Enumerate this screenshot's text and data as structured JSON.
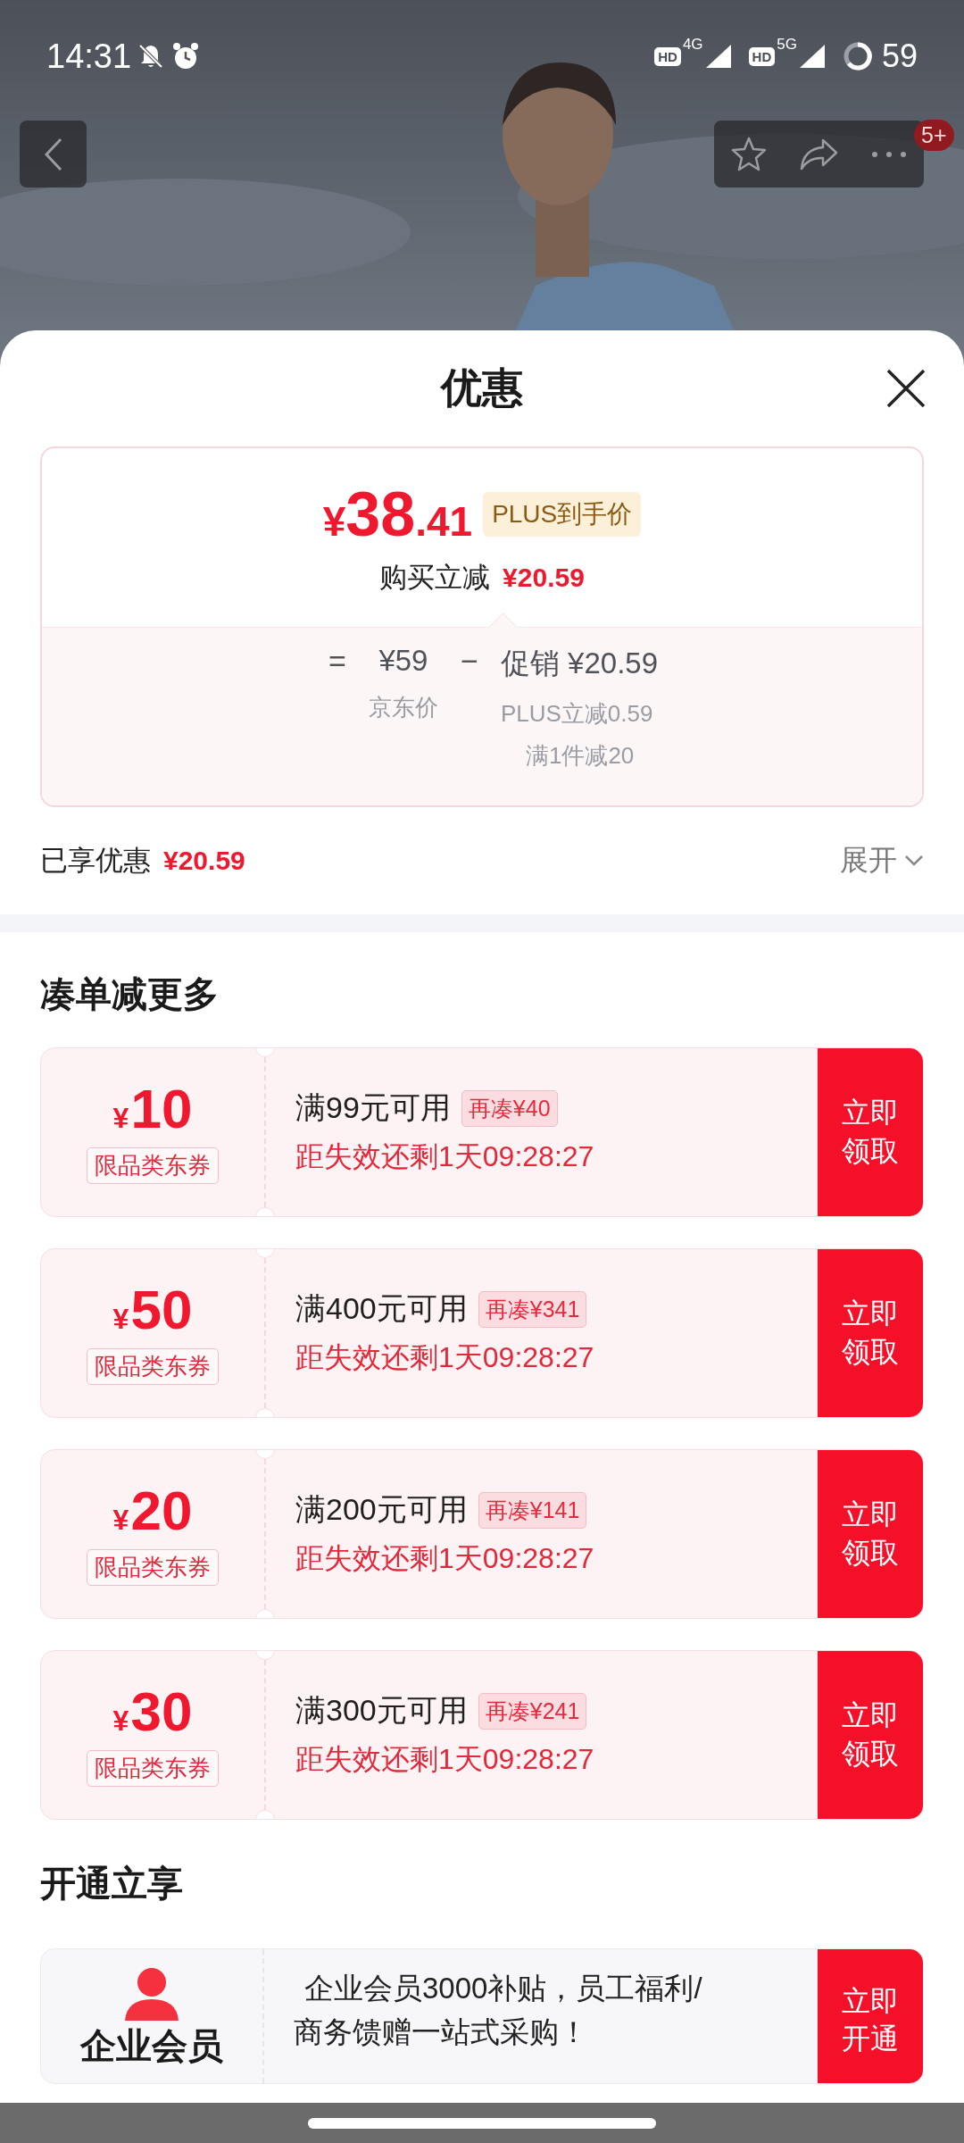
{
  "status_bar": {
    "time": "14:31",
    "networks": [
      {
        "hd": "HD",
        "type": "4G"
      },
      {
        "hd": "HD",
        "type": "5G"
      }
    ],
    "battery": "59"
  },
  "header": {
    "more_badge": "5+"
  },
  "sheet": {
    "title": "优惠"
  },
  "price_card": {
    "price_symbol": "¥",
    "price_integer": "38",
    "price_decimal": ".41",
    "price_tag": "PLUS到手价",
    "reduction_label": "购买立减",
    "reduction_amount": "¥20.59",
    "equals": "=",
    "base_price": "¥59",
    "base_label": "京东价",
    "minus": "−",
    "promo_label": "促销",
    "promo_amount": "¥20.59",
    "promo_details": [
      "PLUS立减0.59",
      "满1件减20"
    ]
  },
  "enjoyed": {
    "label": "已享优惠",
    "amount": "¥20.59",
    "expand": "展开"
  },
  "coupon_section": {
    "title": "凑单减更多",
    "coupons": [
      {
        "symbol": "¥",
        "amount": "10",
        "tag": "限品类东券",
        "condition": "满99元可用",
        "gap": "再凑¥40",
        "countdown": "距失效还剩1天09:28:27",
        "button": "立即领取"
      },
      {
        "symbol": "¥",
        "amount": "50",
        "tag": "限品类东券",
        "condition": "满400元可用",
        "gap": "再凑¥341",
        "countdown": "距失效还剩1天09:28:27",
        "button": "立即领取"
      },
      {
        "symbol": "¥",
        "amount": "20",
        "tag": "限品类东券",
        "condition": "满200元可用",
        "gap": "再凑¥141",
        "countdown": "距失效还剩1天09:28:27",
        "button": "立即领取"
      },
      {
        "symbol": "¥",
        "amount": "30",
        "tag": "限品类东券",
        "condition": "满300元可用",
        "gap": "再凑¥241",
        "countdown": "距失效还剩1天09:28:27",
        "button": "立即领取"
      }
    ]
  },
  "membership_section": {
    "title": "开通立享",
    "card": {
      "name": "企业会员",
      "description_lines": [
        "企业会员3000补贴，员工福利/",
        "商务馈赠一站式采购！"
      ],
      "button": "立即开通"
    }
  }
}
